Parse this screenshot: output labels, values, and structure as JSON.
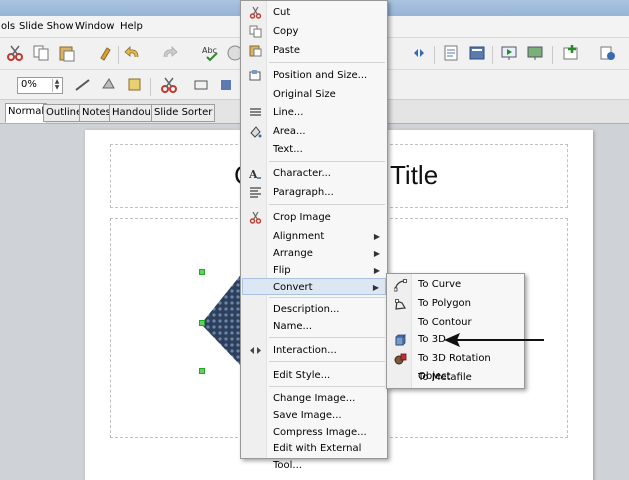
{
  "menubar": {
    "items": [
      {
        "label": "ols"
      },
      {
        "label": "Slide Show"
      },
      {
        "label": "Window"
      },
      {
        "label": "Help"
      }
    ]
  },
  "toolbar2": {
    "zoom_value": "0%"
  },
  "view_tabs": [
    {
      "label": "Normal",
      "active": true
    },
    {
      "label": "Outline",
      "active": false
    },
    {
      "label": "Notes",
      "active": false
    },
    {
      "label": "Handout",
      "active": false
    },
    {
      "label": "Slide Sorter",
      "active": false
    }
  ],
  "slide": {
    "title_left": "C",
    "title_right": "Title"
  },
  "context_menu": {
    "items": [
      {
        "label": "Cut",
        "icon": "scissors-icon",
        "submenu": false
      },
      {
        "label": "Copy",
        "icon": "copy-icon",
        "submenu": false
      },
      {
        "label": "Paste",
        "icon": "paste-icon",
        "submenu": false
      },
      {
        "label": "Position and Size...",
        "icon": "position-size-icon",
        "submenu": false
      },
      {
        "label": "Original Size",
        "icon": "",
        "submenu": false
      },
      {
        "label": "Line...",
        "icon": "line-icon",
        "submenu": false
      },
      {
        "label": "Area...",
        "icon": "area-fill-icon",
        "submenu": false
      },
      {
        "label": "Text...",
        "icon": "",
        "submenu": false
      },
      {
        "label": "Character...",
        "icon": "character-icon",
        "submenu": false
      },
      {
        "label": "Paragraph...",
        "icon": "paragraph-icon",
        "submenu": false
      },
      {
        "label": "Crop Image",
        "icon": "crop-icon",
        "submenu": false
      },
      {
        "label": "Alignment",
        "icon": "",
        "submenu": true
      },
      {
        "label": "Arrange",
        "icon": "",
        "submenu": true
      },
      {
        "label": "Flip",
        "icon": "",
        "submenu": true
      },
      {
        "label": "Convert",
        "icon": "",
        "submenu": true
      },
      {
        "label": "Description...",
        "icon": "",
        "submenu": false
      },
      {
        "label": "Name...",
        "icon": "",
        "submenu": false
      },
      {
        "label": "Interaction...",
        "icon": "interaction-icon",
        "submenu": false
      },
      {
        "label": "Edit Style...",
        "icon": "",
        "submenu": false
      },
      {
        "label": "Change Image...",
        "icon": "",
        "submenu": false
      },
      {
        "label": "Save Image...",
        "icon": "",
        "submenu": false
      },
      {
        "label": "Compress Image...",
        "icon": "",
        "submenu": false
      },
      {
        "label": "Edit with External Tool...",
        "icon": "",
        "submenu": false
      }
    ],
    "highlighted": "Convert"
  },
  "convert_submenu": {
    "items": [
      {
        "label": "To Curve",
        "icon": "to-curve-icon"
      },
      {
        "label": "To Polygon",
        "icon": "to-polygon-icon"
      },
      {
        "label": "To Contour",
        "icon": ""
      },
      {
        "label": "To 3D",
        "icon": "to-3d-icon"
      },
      {
        "label": "To 3D Rotation Object",
        "icon": "to-3d-rotation-icon"
      },
      {
        "label": "To Metafile",
        "icon": ""
      }
    ]
  },
  "colors": {
    "menu_highlight": "#dde7f3",
    "handle": "#66cc66",
    "accent_red": "#c0392b"
  }
}
